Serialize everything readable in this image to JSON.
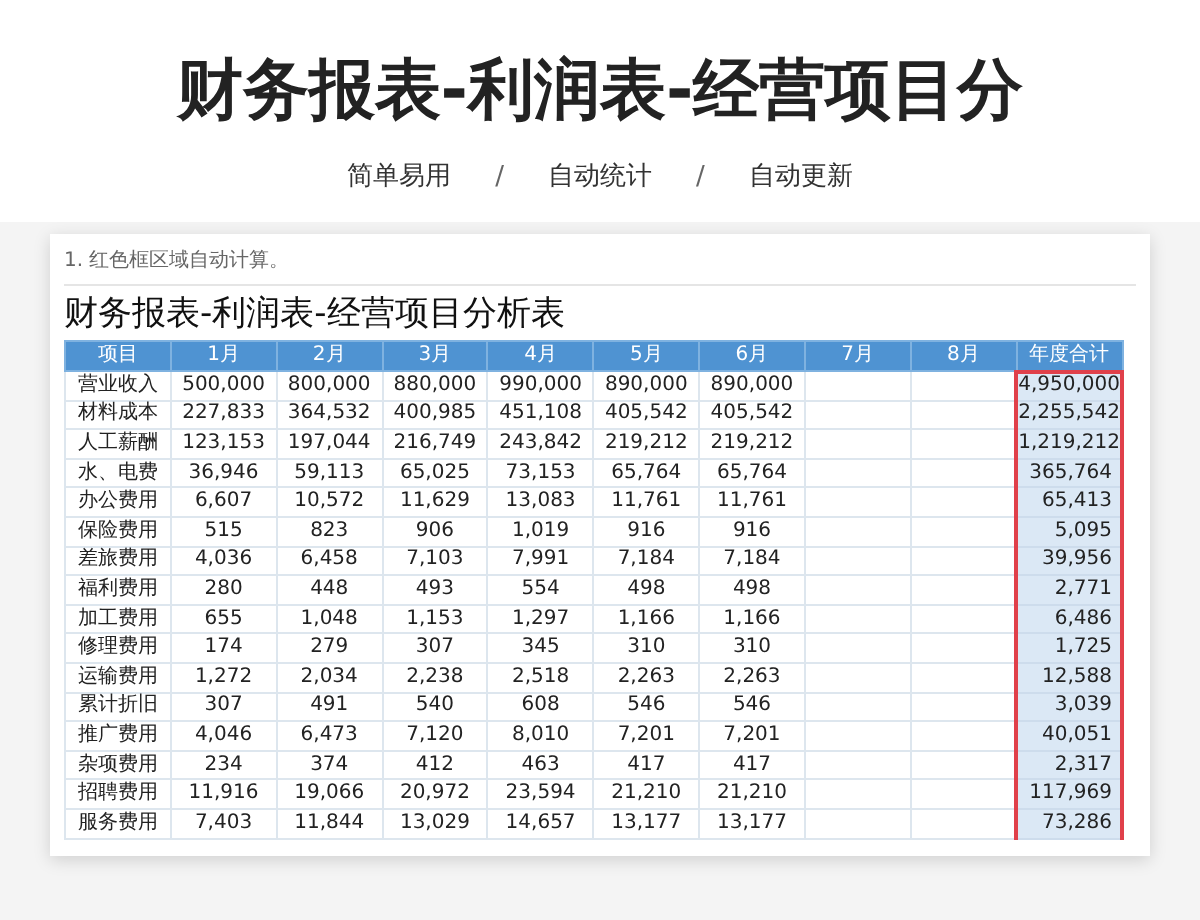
{
  "page_title": "财务报表-利润表-经营项目分",
  "subtitle_items": [
    "简单易用",
    "自动统计",
    "自动更新"
  ],
  "separator": "/",
  "note": "1. 红色框区域自动计算。",
  "table_title": "财务报表-利润表-经营项目分析表",
  "columns": [
    "项目",
    "1月",
    "2月",
    "3月",
    "4月",
    "5月",
    "6月",
    "7月",
    "8月",
    "年度合计"
  ],
  "rows": [
    {
      "item": "营业收入",
      "values": [
        "500,000",
        "800,000",
        "880,000",
        "990,000",
        "890,000",
        "890,000"
      ],
      "total": "4,950,000"
    },
    {
      "item": "材料成本",
      "values": [
        "227,833",
        "364,532",
        "400,985",
        "451,108",
        "405,542",
        "405,542"
      ],
      "total": "2,255,542"
    },
    {
      "item": "人工薪酬",
      "values": [
        "123,153",
        "197,044",
        "216,749",
        "243,842",
        "219,212",
        "219,212"
      ],
      "total": "1,219,212"
    },
    {
      "item": "水、电费",
      "values": [
        "36,946",
        "59,113",
        "65,025",
        "73,153",
        "65,764",
        "65,764"
      ],
      "total": "365,764"
    },
    {
      "item": "办公费用",
      "values": [
        "6,607",
        "10,572",
        "11,629",
        "13,083",
        "11,761",
        "11,761"
      ],
      "total": "65,413"
    },
    {
      "item": "保险费用",
      "values": [
        "515",
        "823",
        "906",
        "1,019",
        "916",
        "916"
      ],
      "total": "5,095"
    },
    {
      "item": "差旅费用",
      "values": [
        "4,036",
        "6,458",
        "7,103",
        "7,991",
        "7,184",
        "7,184"
      ],
      "total": "39,956"
    },
    {
      "item": "福利费用",
      "values": [
        "280",
        "448",
        "493",
        "554",
        "498",
        "498"
      ],
      "total": "2,771"
    },
    {
      "item": "加工费用",
      "values": [
        "655",
        "1,048",
        "1,153",
        "1,297",
        "1,166",
        "1,166"
      ],
      "total": "6,486"
    },
    {
      "item": "修理费用",
      "values": [
        "174",
        "279",
        "307",
        "345",
        "310",
        "310"
      ],
      "total": "1,725"
    },
    {
      "item": "运输费用",
      "values": [
        "1,272",
        "2,034",
        "2,238",
        "2,518",
        "2,263",
        "2,263"
      ],
      "total": "12,588"
    },
    {
      "item": "累计折旧",
      "values": [
        "307",
        "491",
        "540",
        "608",
        "546",
        "546"
      ],
      "total": "3,039"
    },
    {
      "item": "推广费用",
      "values": [
        "4,046",
        "6,473",
        "7,120",
        "8,010",
        "7,201",
        "7,201"
      ],
      "total": "40,051"
    },
    {
      "item": "杂项费用",
      "values": [
        "234",
        "374",
        "412",
        "463",
        "417",
        "417"
      ],
      "total": "2,317"
    },
    {
      "item": "招聘费用",
      "values": [
        "11,916",
        "19,066",
        "20,972",
        "23,594",
        "21,210",
        "21,210"
      ],
      "total": "117,969"
    },
    {
      "item": "服务费用",
      "values": [
        "7,403",
        "11,844",
        "13,029",
        "14,657",
        "13,177",
        "13,177"
      ],
      "total": "73,286"
    }
  ]
}
